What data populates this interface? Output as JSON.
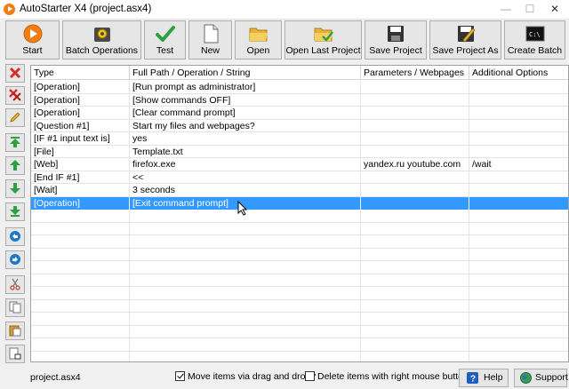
{
  "window": {
    "title": "AutoStarter X4 (project.asx4)"
  },
  "toolbar": {
    "start": "Start",
    "batch": "Batch Operations",
    "test": "Test",
    "new": "New",
    "open": "Open",
    "open_last": "Open Last Project",
    "save": "Save Project",
    "save_as": "Save Project As",
    "create_batch": "Create Batch"
  },
  "grid": {
    "columns": [
      "Type",
      "Full Path / Operation / String",
      "Parameters / Webpages",
      "Additional Options"
    ],
    "rows": [
      [
        "[Operation]",
        "[Run prompt as administrator]",
        "",
        ""
      ],
      [
        "[Operation]",
        "[Show commands OFF]",
        "",
        ""
      ],
      [
        "[Operation]",
        "[Clear command prompt]",
        "",
        ""
      ],
      [
        "[Question #1]",
        "Start my files and webpages?",
        "",
        ""
      ],
      [
        "[IF #1 input text is]",
        "yes",
        "",
        ""
      ],
      [
        "[File]",
        "Template.txt",
        "",
        ""
      ],
      [
        "[Web]",
        "firefox.exe",
        "yandex.ru youtube.com",
        "/wait"
      ],
      [
        "[End IF #1]",
        "<<",
        "",
        ""
      ],
      [
        "[Wait]",
        "3 seconds",
        "",
        ""
      ],
      [
        "[Operation]",
        "[Exit command prompt]",
        "",
        ""
      ]
    ],
    "selected_row": 9,
    "empty_rows": 12
  },
  "status": {
    "file": "project.asx4",
    "drag_label": "Move items via drag and drop?",
    "drag_checked": true,
    "delete_label": "Delete items with right mouse button?",
    "delete_checked": false,
    "help": "Help",
    "support": "Support"
  },
  "icons": {
    "start": "play-icon",
    "batch": "gear-icon",
    "test": "checkmark-icon",
    "new": "document-icon",
    "open": "folder-icon",
    "open_last": "folder-check-icon",
    "save": "floppy-icon",
    "save_as": "floppy-pen-icon",
    "create_batch": "terminal-icon"
  },
  "colors": {
    "selection": "#3399ff",
    "start_orange": "#f07d16",
    "green": "#2ea043",
    "red": "#d32f2f"
  }
}
